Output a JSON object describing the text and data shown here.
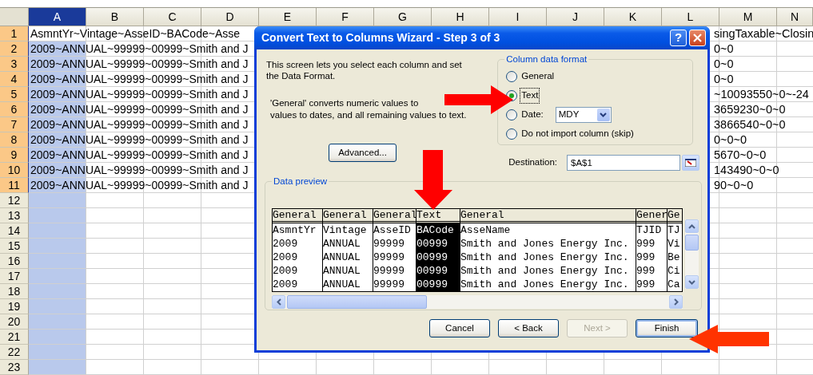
{
  "spreadsheet": {
    "columns": [
      {
        "label": "A",
        "selected": true
      },
      {
        "label": "B",
        "selected": false
      },
      {
        "label": "C",
        "selected": false
      },
      {
        "label": "D",
        "selected": false
      },
      {
        "label": "E",
        "selected": false
      },
      {
        "label": "F",
        "selected": false
      },
      {
        "label": "G",
        "selected": false
      },
      {
        "label": "H",
        "selected": false
      },
      {
        "label": "I",
        "selected": false
      },
      {
        "label": "J",
        "selected": false
      },
      {
        "label": "K",
        "selected": false
      },
      {
        "label": "L",
        "selected": false
      },
      {
        "label": "M",
        "selected": false
      },
      {
        "label": "N",
        "selected": false
      }
    ],
    "rows": [
      {
        "number": "1",
        "highlighted": true,
        "active": true,
        "text": "AsmntYr~Vintage~AsseID~BACode~Asse",
        "right_text": "singTaxable~Closin"
      },
      {
        "number": "2",
        "highlighted": true,
        "active": false,
        "text": "2009~ANNUAL~99999~00999~Smith and J",
        "right_text": "0~0"
      },
      {
        "number": "3",
        "highlighted": true,
        "active": false,
        "text": "2009~ANNUAL~99999~00999~Smith and J",
        "right_text": "0~0"
      },
      {
        "number": "4",
        "highlighted": true,
        "active": false,
        "text": "2009~ANNUAL~99999~00999~Smith and J",
        "right_text": "0~0"
      },
      {
        "number": "5",
        "highlighted": true,
        "active": false,
        "text": "2009~ANNUAL~99999~00999~Smith and J",
        "right_text": "~10093550~0~-24"
      },
      {
        "number": "6",
        "highlighted": true,
        "active": false,
        "text": "2009~ANNUAL~99999~00999~Smith and J",
        "right_text": "3659230~0~0"
      },
      {
        "number": "7",
        "highlighted": true,
        "active": false,
        "text": "2009~ANNUAL~99999~00999~Smith and J",
        "right_text": "3866540~0~0"
      },
      {
        "number": "8",
        "highlighted": true,
        "active": false,
        "text": "2009~ANNUAL~99999~00999~Smith and J",
        "right_text": "0~0~0"
      },
      {
        "number": "9",
        "highlighted": true,
        "active": false,
        "text": "2009~ANNUAL~99999~00999~Smith and J",
        "right_text": "5670~0~0"
      },
      {
        "number": "10",
        "highlighted": true,
        "active": false,
        "text": "2009~ANNUAL~99999~00999~Smith and J",
        "right_text": "143490~0~0"
      },
      {
        "number": "11",
        "highlighted": true,
        "active": false,
        "text": "2009~ANNUAL~99999~00999~Smith and J",
        "right_text": "90~0~0"
      },
      {
        "number": "12",
        "highlighted": false,
        "active": false
      },
      {
        "number": "13",
        "highlighted": false,
        "active": false
      },
      {
        "number": "14",
        "highlighted": false,
        "active": false
      },
      {
        "number": "15",
        "highlighted": false,
        "active": false
      },
      {
        "number": "16",
        "highlighted": false,
        "active": false
      },
      {
        "number": "17",
        "highlighted": false,
        "active": false
      },
      {
        "number": "18",
        "highlighted": false,
        "active": false
      },
      {
        "number": "19",
        "highlighted": false,
        "active": false
      },
      {
        "number": "20",
        "highlighted": false,
        "active": false
      },
      {
        "number": "21",
        "highlighted": false,
        "active": false
      },
      {
        "number": "22",
        "highlighted": false,
        "active": false
      },
      {
        "number": "23",
        "highlighted": false,
        "active": false
      }
    ]
  },
  "dialog": {
    "title": "Convert Text to Columns Wizard - Step 3 of 3",
    "help": "?",
    "description": "This screen lets you select each column and set the Data Format.",
    "note_lines": [
      "'General' converts numeric values to",
      "values to dates, and all remaining values to text."
    ],
    "format_group": {
      "label": "Column data format",
      "date_format": "MDY",
      "options": [
        {
          "label": "General",
          "selected": false,
          "kind": "plain"
        },
        {
          "label": "Text",
          "selected": true,
          "kind": "plain"
        },
        {
          "label": "Date:",
          "selected": false,
          "kind": "date"
        },
        {
          "label": "Do not import column (skip)",
          "selected": false,
          "kind": "plain"
        }
      ]
    },
    "advanced_button": "Advanced...",
    "destination": {
      "label": "Destination:",
      "value": "$A$1"
    },
    "preview": {
      "label": "Data preview",
      "columns": [
        {
          "type": "General",
          "selected": false
        },
        {
          "type": "General",
          "selected": false
        },
        {
          "type": "General",
          "selected": false
        },
        {
          "type": "Text",
          "selected": true
        },
        {
          "type": "General",
          "selected": false
        },
        {
          "type": "Gener",
          "selected": false
        },
        {
          "type": "Ge",
          "selected": false
        }
      ],
      "rows": [
        [
          "AsmntYr",
          "Vintage",
          "AsseID",
          "BACode",
          "AsseName",
          "TJID",
          "TJ"
        ],
        [
          "2009",
          "ANNUAL",
          "99999",
          "00999",
          "Smith and Jones Energy Inc.",
          "999",
          "Vi"
        ],
        [
          "2009",
          "ANNUAL",
          "99999",
          "00999",
          "Smith and Jones Energy Inc.",
          "999",
          "Be"
        ],
        [
          "2009",
          "ANNUAL",
          "99999",
          "00999",
          "Smith and Jones Energy Inc.",
          "999",
          "Ci"
        ],
        [
          "2009",
          "ANNUAL",
          "99999",
          "00999",
          "Smith and Jones Energy Inc.",
          "999",
          "Ca"
        ]
      ]
    },
    "buttons": [
      {
        "label": "Cancel",
        "disabled": false,
        "default": false
      },
      {
        "label": "< Back",
        "disabled": false,
        "default": false
      },
      {
        "label": "Next >",
        "disabled": true,
        "default": false
      },
      {
        "label": "Finish",
        "disabled": false,
        "default": true
      }
    ]
  }
}
